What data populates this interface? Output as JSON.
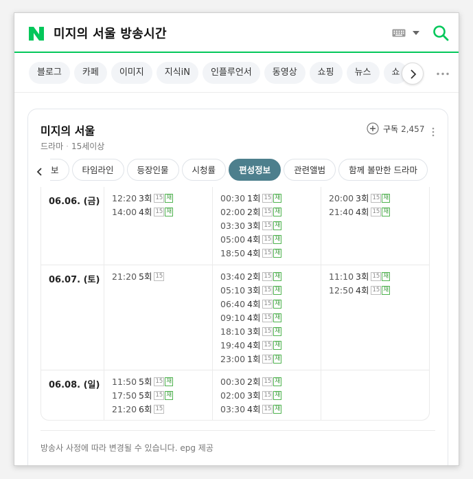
{
  "header": {
    "title": "미지의 서울 방송시간"
  },
  "tabs": [
    "블로그",
    "카페",
    "이미지",
    "지식iN",
    "인플루언서",
    "동영상",
    "쇼핑",
    "뉴스",
    "쇼"
  ],
  "card": {
    "title": "미지의 서울",
    "genre": "드라마",
    "rating": "15세이상",
    "subscribe_label": "구독",
    "subscribe_count": "2,457"
  },
  "subtabs": [
    {
      "label": "보",
      "active": false
    },
    {
      "label": "타임라인",
      "active": false
    },
    {
      "label": "등장인물",
      "active": false
    },
    {
      "label": "시청률",
      "active": false
    },
    {
      "label": "편성정보",
      "active": true
    },
    {
      "label": "관련앨범",
      "active": false
    },
    {
      "label": "함께 볼만한 드라마",
      "active": false
    }
  ],
  "schedule": [
    {
      "date": "06.06. (금)",
      "cols": [
        [
          {
            "time": "12:20",
            "ep": "3회",
            "rating": "15",
            "re": "재"
          },
          {
            "time": "14:00",
            "ep": "4회",
            "rating": "15",
            "re": "재"
          }
        ],
        [
          {
            "time": "00:30",
            "ep": "1회",
            "rating": "15",
            "re": "재"
          },
          {
            "time": "02:00",
            "ep": "2회",
            "rating": "15",
            "re": "재"
          },
          {
            "time": "03:30",
            "ep": "3회",
            "rating": "15",
            "re": "재"
          },
          {
            "time": "05:00",
            "ep": "4회",
            "rating": "15",
            "re": "재"
          },
          {
            "time": "18:50",
            "ep": "4회",
            "rating": "15",
            "re": "재"
          }
        ],
        [
          {
            "time": "20:00",
            "ep": "3회",
            "rating": "15",
            "re": "재"
          },
          {
            "time": "21:40",
            "ep": "4회",
            "rating": "15",
            "re": "재"
          }
        ]
      ]
    },
    {
      "date": "06.07. (토)",
      "cols": [
        [
          {
            "time": "21:20",
            "ep": "5회",
            "rating": "15",
            "re": ""
          }
        ],
        [
          {
            "time": "03:40",
            "ep": "2회",
            "rating": "15",
            "re": "재"
          },
          {
            "time": "05:10",
            "ep": "3회",
            "rating": "15",
            "re": "재"
          },
          {
            "time": "06:40",
            "ep": "4회",
            "rating": "15",
            "re": "재"
          },
          {
            "time": "09:10",
            "ep": "4회",
            "rating": "15",
            "re": "재"
          },
          {
            "time": "18:10",
            "ep": "3회",
            "rating": "15",
            "re": "재"
          },
          {
            "time": "19:40",
            "ep": "4회",
            "rating": "15",
            "re": "재"
          },
          {
            "time": "23:00",
            "ep": "1회",
            "rating": "15",
            "re": "재"
          }
        ],
        [
          {
            "time": "11:10",
            "ep": "3회",
            "rating": "15",
            "re": "재"
          },
          {
            "time": "12:50",
            "ep": "4회",
            "rating": "15",
            "re": "재"
          }
        ]
      ]
    },
    {
      "date": "06.08. (일)",
      "cols": [
        [
          {
            "time": "11:50",
            "ep": "5회",
            "rating": "15",
            "re": "재"
          },
          {
            "time": "17:50",
            "ep": "5회",
            "rating": "15",
            "re": "재"
          },
          {
            "time": "21:20",
            "ep": "6회",
            "rating": "15",
            "re": ""
          }
        ],
        [
          {
            "time": "00:30",
            "ep": "2회",
            "rating": "15",
            "re": "재"
          },
          {
            "time": "02:00",
            "ep": "3회",
            "rating": "15",
            "re": "재"
          },
          {
            "time": "03:30",
            "ep": "4회",
            "rating": "15",
            "re": "재"
          }
        ],
        []
      ]
    }
  ],
  "footer": "방송사 사정에 따라 변경될 수 있습니다. epg 제공",
  "colors": {
    "brand": "#03c75a",
    "active_tab": "#4d7f8d",
    "rerun_badge": "#4fb34f"
  }
}
